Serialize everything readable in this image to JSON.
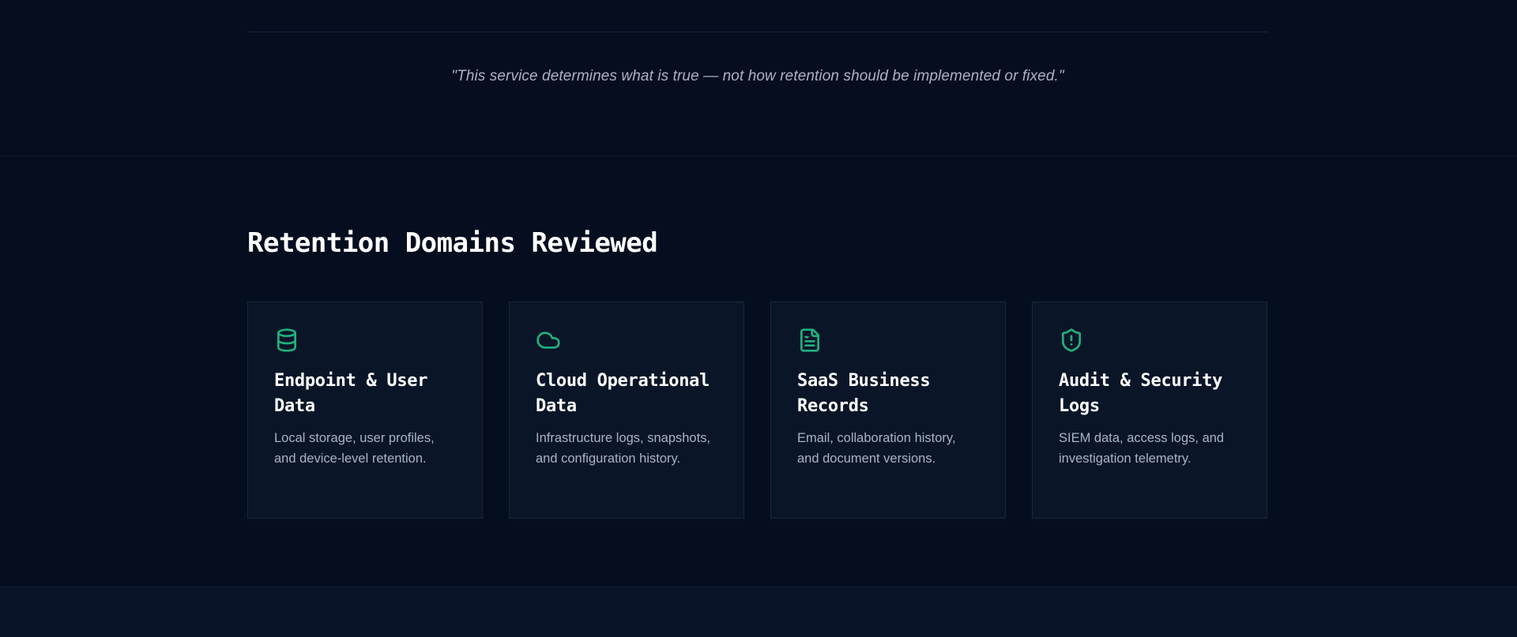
{
  "quote": {
    "text": "\"This service determines what is true — not how retention should be implemented or fixed.\""
  },
  "domains": {
    "title": "Retention Domains Reviewed",
    "accent_color": "#22b07d",
    "cards": [
      {
        "icon": "database-icon",
        "title": "Endpoint & User Data",
        "description": "Local storage, user profiles, and device-level retention."
      },
      {
        "icon": "cloud-icon",
        "title": "Cloud Operational Data",
        "description": "Infrastructure logs, snapshots, and configuration history."
      },
      {
        "icon": "document-icon",
        "title": "SaaS Business Records",
        "description": "Email, collaboration history, and document versions."
      },
      {
        "icon": "shield-alert-icon",
        "title": "Audit & Security Logs",
        "description": "SIEM data, access logs, and investigation telemetry."
      }
    ]
  }
}
